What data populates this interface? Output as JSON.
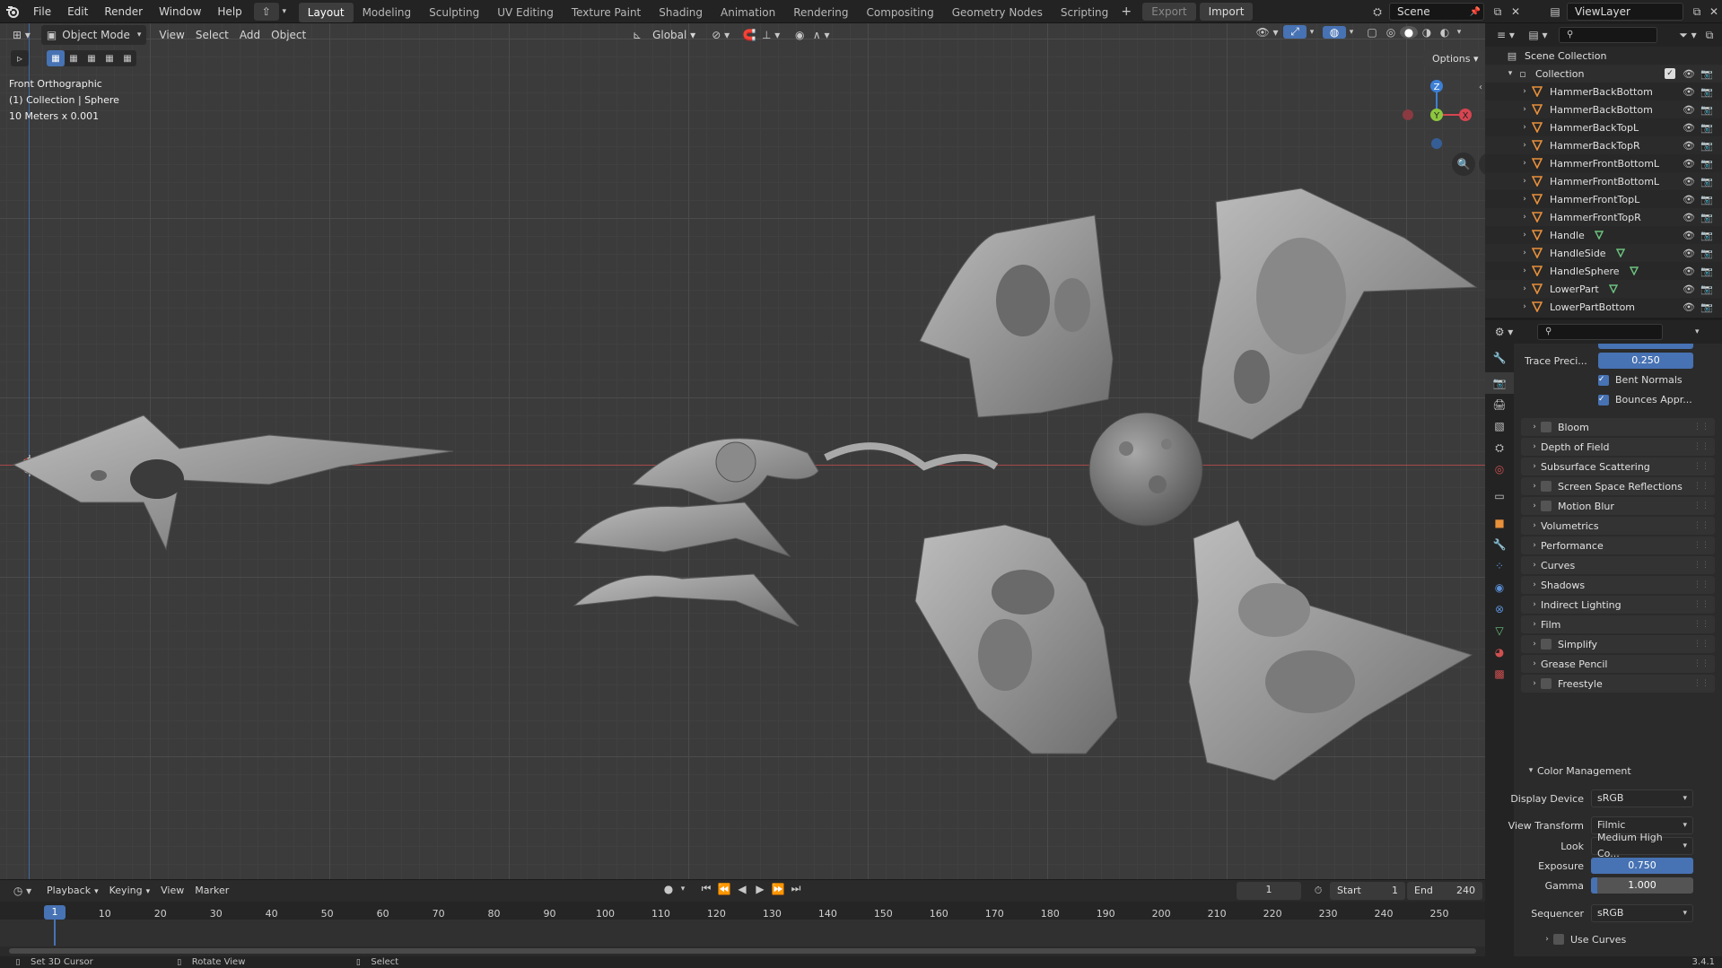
{
  "topbar": {
    "menus": [
      "File",
      "Edit",
      "Render",
      "Window",
      "Help"
    ],
    "workspaces": [
      "Layout",
      "Modeling",
      "Sculpting",
      "UV Editing",
      "Texture Paint",
      "Shading",
      "Animation",
      "Rendering",
      "Compositing",
      "Geometry Nodes",
      "Scripting"
    ],
    "active_workspace": "Layout",
    "export_label": "Export",
    "import_label": "Import",
    "scene": "Scene",
    "view_layer": "ViewLayer"
  },
  "viewport_header": {
    "mode": "Object Mode",
    "menus": [
      "View",
      "Select",
      "Add",
      "Object"
    ],
    "orientation": "Global",
    "options_label": "Options"
  },
  "viewport_overlay": {
    "view_name": "Front Orthographic",
    "collection_info": "(1) Collection | Sphere",
    "scale_info": "10 Meters x 0.001"
  },
  "outliner": {
    "root": "Scene Collection",
    "collection": "Collection",
    "items": [
      {
        "name": "HammerBackBottom",
        "mesh_badge": false
      },
      {
        "name": "HammerBackBottom",
        "mesh_badge": false
      },
      {
        "name": "HammerBackTopL",
        "mesh_badge": false
      },
      {
        "name": "HammerBackTopR",
        "mesh_badge": false
      },
      {
        "name": "HammerFrontBottomL",
        "mesh_badge": false
      },
      {
        "name": "HammerFrontBottomL",
        "mesh_badge": false
      },
      {
        "name": "HammerFrontTopL",
        "mesh_badge": false
      },
      {
        "name": "HammerFrontTopR",
        "mesh_badge": false
      },
      {
        "name": "Handle",
        "mesh_badge": true
      },
      {
        "name": "HandleSide",
        "mesh_badge": true
      },
      {
        "name": "HandleSphere",
        "mesh_badge": true
      },
      {
        "name": "LowerPart",
        "mesh_badge": true
      },
      {
        "name": "LowerPartBottom",
        "mesh_badge": false
      }
    ]
  },
  "properties": {
    "trace_precision_label": "Trace Preci...",
    "trace_precision_value": "0.250",
    "trace_precision_fraction": 1.0,
    "bent_normals_label": "Bent Normals",
    "bounces_label": "Bounces Appr...",
    "panels": [
      {
        "label": "Bloom",
        "checkbox": true
      },
      {
        "label": "Depth of Field",
        "checkbox": false
      },
      {
        "label": "Subsurface Scattering",
        "checkbox": false
      },
      {
        "label": "Screen Space Reflections",
        "checkbox": true
      },
      {
        "label": "Motion Blur",
        "checkbox": true
      },
      {
        "label": "Volumetrics",
        "checkbox": false
      },
      {
        "label": "Performance",
        "checkbox": false
      },
      {
        "label": "Curves",
        "checkbox": false
      },
      {
        "label": "Shadows",
        "checkbox": false
      },
      {
        "label": "Indirect Lighting",
        "checkbox": false
      },
      {
        "label": "Film",
        "checkbox": false
      },
      {
        "label": "Simplify",
        "checkbox": true
      },
      {
        "label": "Grease Pencil",
        "checkbox": false
      },
      {
        "label": "Freestyle",
        "checkbox": true
      }
    ],
    "color_management": {
      "title": "Color Management",
      "display_device_label": "Display Device",
      "display_device": "sRGB",
      "view_transform_label": "View Transform",
      "view_transform": "Filmic",
      "look_label": "Look",
      "look": "Medium High Co...",
      "exposure_label": "Exposure",
      "exposure": "0.750",
      "exposure_fraction": 1.0,
      "gamma_label": "Gamma",
      "gamma": "1.000",
      "gamma_fraction": 0.06,
      "sequencer_label": "Sequencer",
      "sequencer": "sRGB",
      "use_curves_label": "Use Curves"
    }
  },
  "timeline": {
    "menus": [
      "Playback",
      "Keying",
      "View",
      "Marker"
    ],
    "current_frame": "1",
    "start_label": "Start",
    "start": "1",
    "end_label": "End",
    "end": "240",
    "ticks": [
      "1",
      "10",
      "20",
      "30",
      "40",
      "50",
      "60",
      "70",
      "80",
      "90",
      "100",
      "110",
      "120",
      "130",
      "140",
      "150",
      "160",
      "170",
      "180",
      "190",
      "200",
      "210",
      "220",
      "230",
      "240",
      "250"
    ]
  },
  "statusbar": {
    "hint1": "Set 3D Cursor",
    "hint2": "Rotate View",
    "hint3": "Select",
    "version": "3.4.1"
  },
  "colors": {
    "accent": "#4772b3",
    "object_orange": "#e8903a",
    "mesh_green": "#6cc27e",
    "x_axis": "#d64550",
    "y_axis": "#8cc63e",
    "z_axis": "#3c7fd6"
  }
}
